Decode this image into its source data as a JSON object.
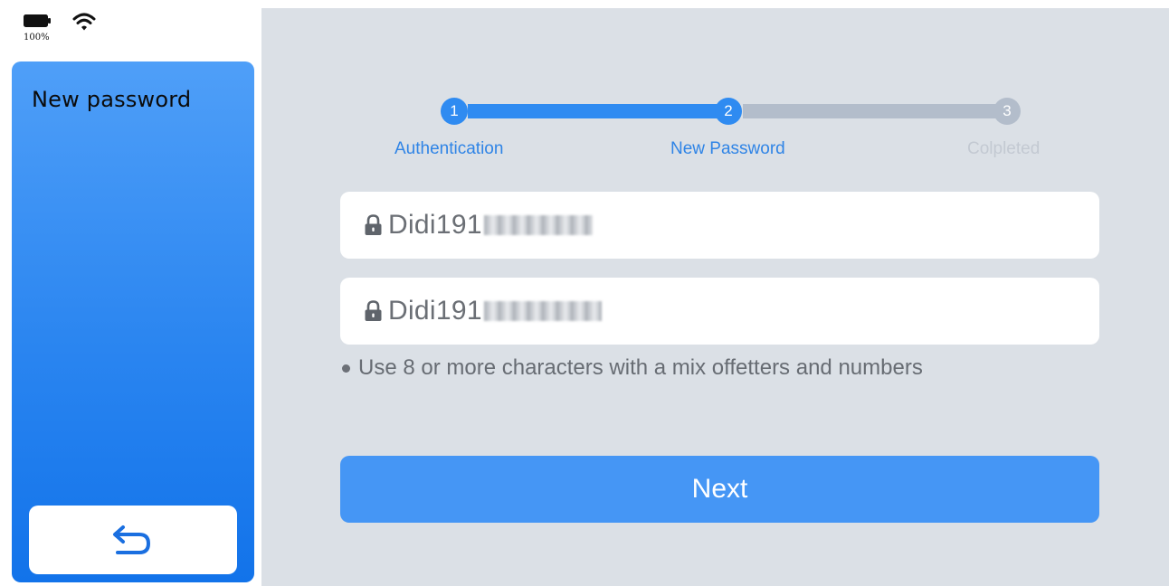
{
  "status_bar": {
    "battery_percent": "100%",
    "battery_icon": "battery-full-icon",
    "wifi_icon": "wifi-icon"
  },
  "sidebar": {
    "title": "New password",
    "back_icon": "undo-arrow-icon"
  },
  "stepper": {
    "steps": [
      {
        "number": "1",
        "label": "Authentication",
        "state": "done"
      },
      {
        "number": "2",
        "label": "New Password",
        "state": "active"
      },
      {
        "number": "3",
        "label": "Colpleted",
        "state": "inactive"
      }
    ]
  },
  "form": {
    "password_field": {
      "value": "Didi191",
      "icon": "lock-icon"
    },
    "confirm_field": {
      "value": "Didi191",
      "icon": "lock-icon"
    },
    "hint": "Use 8 or more characters with a mix offetters and numbers",
    "next_label": "Next"
  },
  "colors": {
    "accent": "#2f8bf1",
    "button": "#4596f5",
    "background": "#dbe0e6",
    "inactive": "#b3bdcb"
  }
}
